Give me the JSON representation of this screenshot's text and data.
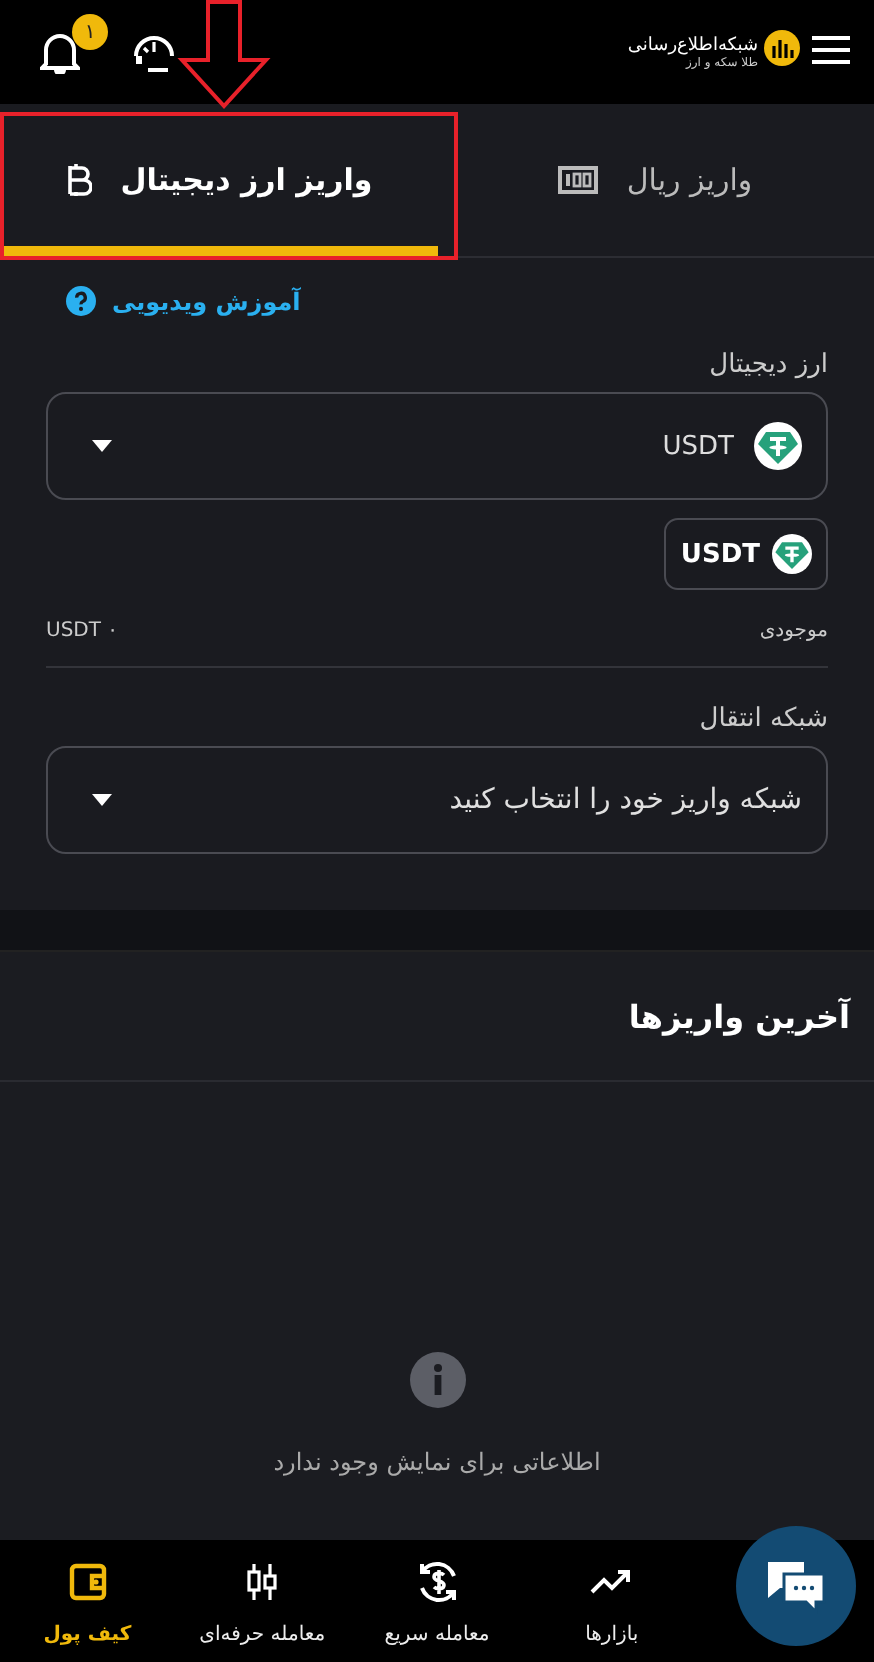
{
  "header": {
    "logo": {
      "title": "شبکه‌اطلاع‌رسانی",
      "subtitle": "طلا سکه و ارز"
    },
    "notifications": {
      "count": "۱"
    }
  },
  "annotation": {
    "kind": "arrow-frame"
  },
  "tabs": [
    {
      "label": "واریز ریال",
      "selected": false
    },
    {
      "label": "واریز ارز دیجیتال",
      "selected": true
    }
  ],
  "help_link": "آموزش ویدیویی",
  "currency_field": {
    "label": "ارز دیجیتال",
    "value": "USDT"
  },
  "currency_chip": "USDT",
  "balance": {
    "label": "موجودی",
    "value": "USDT ۰"
  },
  "network_field": {
    "label": "شبکه انتقال",
    "placeholder": "شبکه واریز خود را انتخاب کنید"
  },
  "recent": {
    "title": "آخرین واریزها",
    "empty_message": "اطلاعاتی برای نمایش وجود ندارد"
  },
  "bottom_nav": [
    {
      "label": "بازارها",
      "selected": false
    },
    {
      "label": "معامله سریع",
      "selected": false
    },
    {
      "label": "معامله حرفه‌ای",
      "selected": false
    },
    {
      "label": "کیف پول",
      "selected": true
    }
  ]
}
